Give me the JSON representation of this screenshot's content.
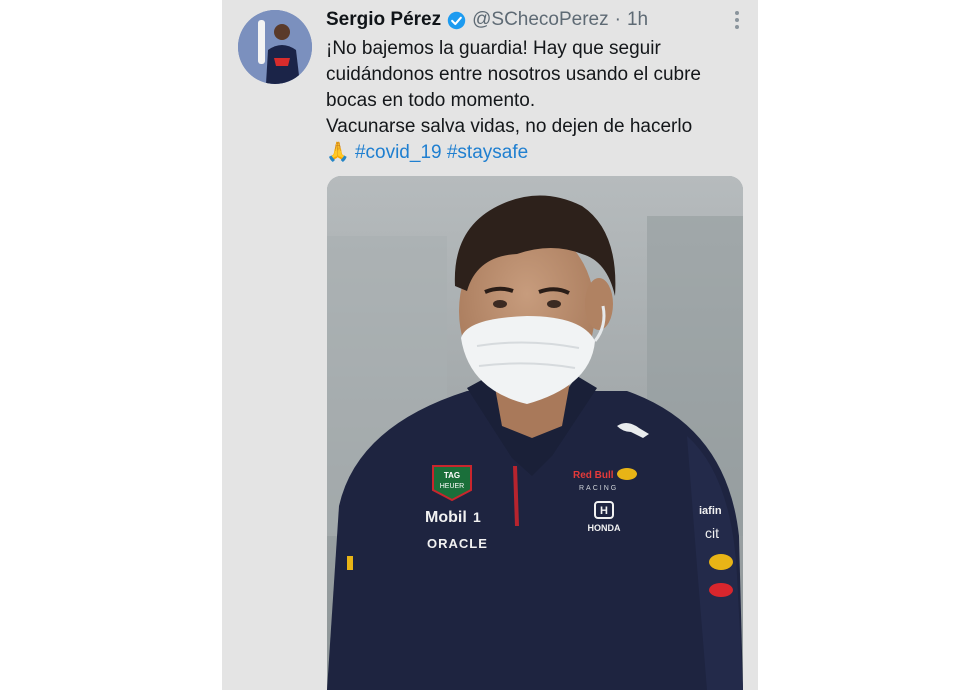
{
  "tweet": {
    "author_name": "Sergio Pérez",
    "handle": "@SChecoPerez",
    "separator": "·",
    "time": "1h",
    "text_line_1": "¡No bajemos la guardia! Hay que seguir cuidándonos entre nosotros usando el cubre bocas en todo momento.",
    "text_line_2": "Vacunarse salva vidas, no dejen de hacerlo",
    "emoji": "🙏",
    "hashtag_1": "#covid_19",
    "hashtag_2": "#staysafe",
    "icons": {
      "verified": "verified-badge-icon",
      "more": "more-options-icon"
    },
    "colors": {
      "link": "#1f7fd0",
      "verified": "#1d9bf0"
    }
  },
  "photo": {
    "shirt_logos": {
      "tag_heuer_line1": "TAG",
      "tag_heuer_line2": "HEUER",
      "mobil": "Mobil",
      "mobil_suffix": "1",
      "oracle": "ORACLE",
      "redbull": "Red Bull",
      "racing": "RACING",
      "honda": "HONDA",
      "side_text_1": "iafin",
      "side_text_2": "cit"
    }
  }
}
